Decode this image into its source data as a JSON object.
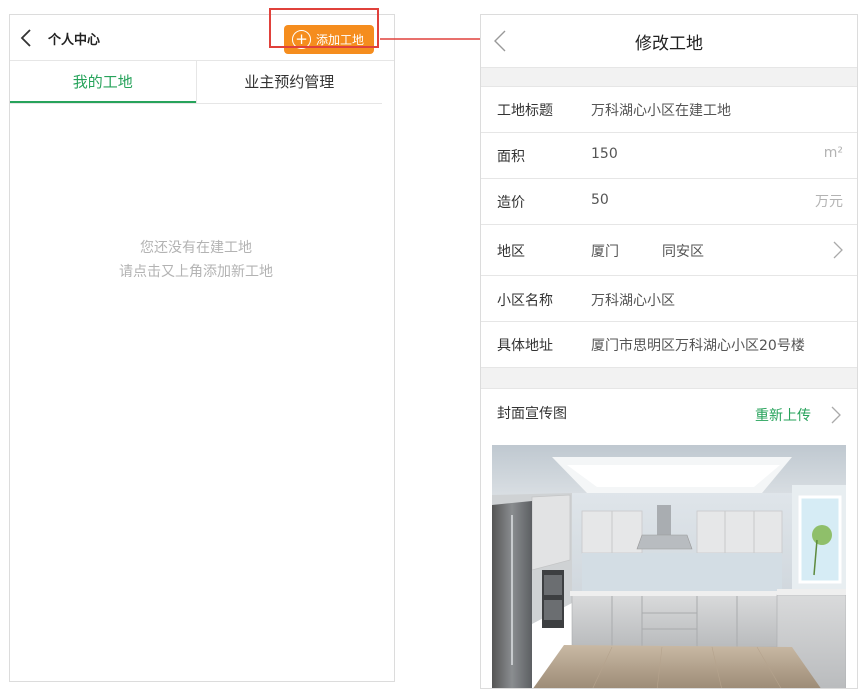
{
  "left_screen": {
    "header": {
      "back_icon": "chevron-left-icon",
      "title": "个人中心"
    },
    "add_button": {
      "icon": "plus-circle-icon",
      "label": "添加工地",
      "color": "#f58d1e"
    },
    "tabs": [
      {
        "label": "我的工地",
        "active": true
      },
      {
        "label": "业主预约管理",
        "active": false
      }
    ],
    "empty_state": {
      "line1": "您还没有在建工地",
      "line2": "请点击又上角添加新工地"
    }
  },
  "right_screen": {
    "header": {
      "back_icon": "chevron-left-icon",
      "title": "修改工地"
    },
    "fields": {
      "title": {
        "label": "工地标题",
        "value": "万科湖心小区在建工地"
      },
      "area": {
        "label": "面积",
        "value": "150",
        "unit": "m²"
      },
      "price": {
        "label": "造价",
        "value": "50",
        "unit": "万元"
      },
      "region": {
        "label": "地区",
        "city": "厦门",
        "district": "同安区"
      },
      "community": {
        "label": "小区名称",
        "value": "万科湖心小区"
      },
      "address": {
        "label": "具体地址",
        "value": "厦门市思明区万科湖心小区20号楼"
      }
    },
    "cover": {
      "label": "封面宣传图",
      "reupload_label": "重新上传",
      "image": "kitchen-photo"
    }
  },
  "colors": {
    "accent_green": "#27a35b",
    "highlight_red": "#e0413b",
    "button_orange": "#f58d1e"
  }
}
